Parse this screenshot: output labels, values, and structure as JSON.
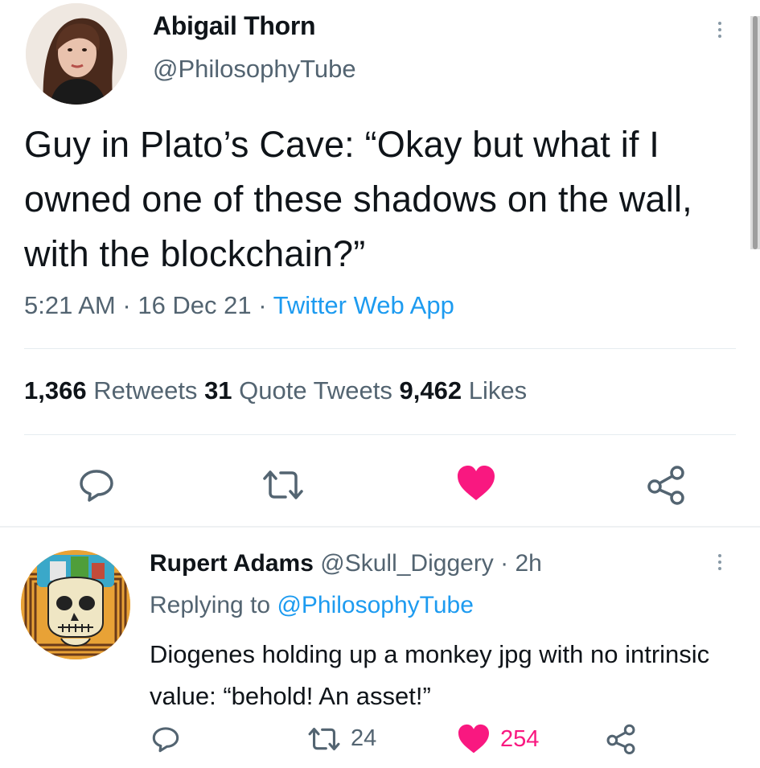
{
  "main_tweet": {
    "author_name": "Abigail Thorn",
    "author_handle": "@PhilosophyTube",
    "text": "Guy in Plato’s Cave: “Okay but what if I owned one of these shadows on the wall, with the blockchain?”",
    "time": "5:21 AM",
    "date": "16 Dec 21",
    "source": "Twitter Web App",
    "separator": "·",
    "stats": {
      "retweets_count": "1,366",
      "retweets_label": "Retweets",
      "quotes_count": "31",
      "quotes_label": "Quote Tweets",
      "likes_count": "9,462",
      "likes_label": "Likes"
    },
    "actions": [
      "reply-icon",
      "retweet-icon",
      "heart-icon",
      "share-icon"
    ],
    "liked": true
  },
  "reply": {
    "author_name": "Rupert Adams",
    "author_handle": "@Skull_Diggery",
    "separator": "·",
    "time_ago": "2h",
    "replying_label": "Replying to",
    "replying_to": "@PhilosophyTube",
    "text": "Diogenes holding up a monkey jpg with no intrinsic value: “behold! An asset!”",
    "retweet_count": "24",
    "like_count": "254",
    "liked": true
  },
  "colors": {
    "text": "#0f1419",
    "secondary": "#536471",
    "link": "#1d9bf0",
    "like": "#f91880",
    "divider": "#e6ecf0"
  }
}
